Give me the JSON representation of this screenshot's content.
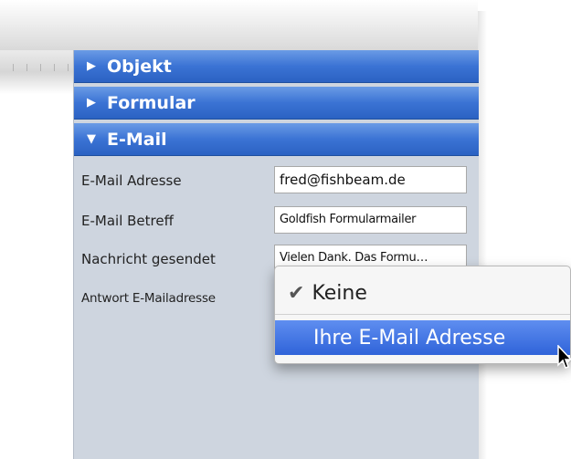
{
  "inspector": {
    "sections": [
      {
        "label": "Objekt",
        "state": "collapsed",
        "icon": "triangle-right-icon"
      },
      {
        "label": "Formular",
        "state": "collapsed",
        "icon": "triangle-right-icon"
      },
      {
        "label": "E-Mail",
        "state": "expanded",
        "icon": "triangle-down-icon"
      }
    ],
    "email": {
      "address_label": "E-Mail Adresse",
      "address_value": "fred@fishbeam.de",
      "subject_label": "E-Mail Betreff",
      "subject_value": "Goldfish Formularmailer",
      "message_label": "Nachricht gesendet",
      "message_value": "Vielen Dank. Das Formu…",
      "reply_label": "Antwort E-Mailadresse"
    }
  },
  "popup_menu": {
    "items": [
      {
        "label": "Keine",
        "checked": true
      },
      {
        "label": "Ihre E-Mail Adresse",
        "highlighted": true
      }
    ]
  },
  "colors": {
    "header_blue": "#3b73d4",
    "panel_bg": "#ced5df",
    "menu_highlight": "#2f63d9"
  }
}
